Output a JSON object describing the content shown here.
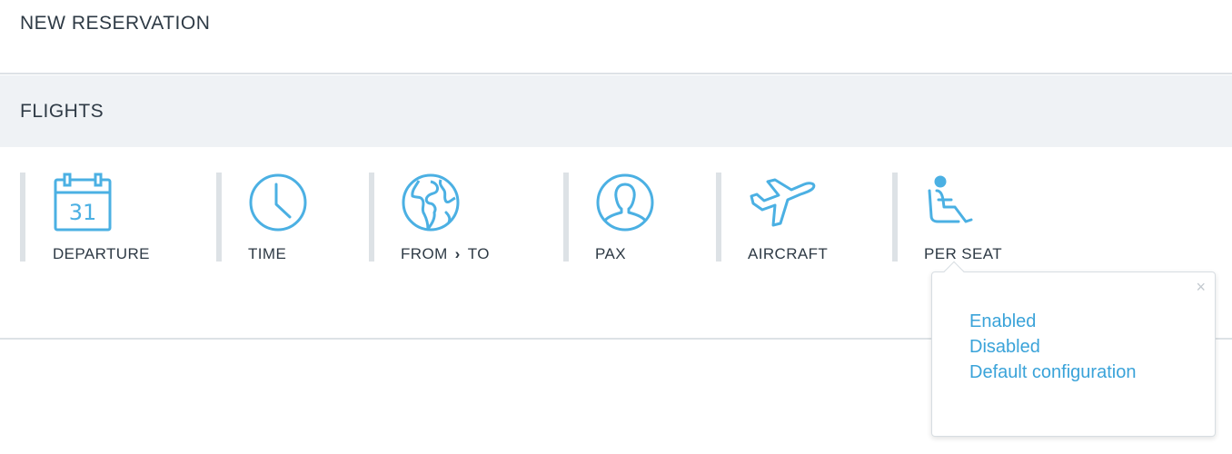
{
  "header": {
    "title": "NEW RESERVATION"
  },
  "section": {
    "title": "FLIGHTS"
  },
  "columns": {
    "departure": {
      "label": "DEPARTURE",
      "icon": "calendar-icon",
      "calendar_day": "31"
    },
    "time": {
      "label": "TIME",
      "icon": "clock-icon"
    },
    "route": {
      "from_label": "FROM",
      "separator": "›",
      "to_label": "TO",
      "icon": "globe-icon"
    },
    "pax": {
      "label": "PAX",
      "icon": "person-icon"
    },
    "aircraft": {
      "label": "AIRCRAFT",
      "icon": "airplane-icon"
    },
    "per_seat": {
      "label": "PER SEAT",
      "icon": "seat-icon"
    }
  },
  "popover": {
    "close_symbol": "×",
    "options": [
      "Enabled",
      "Disabled",
      "Default configuration"
    ]
  },
  "colors": {
    "accent": "#3aa3d9",
    "icon": "#4bb0e3",
    "divider": "#dde2e6",
    "section_bg": "#eff2f5",
    "text": "#2e3a45"
  }
}
